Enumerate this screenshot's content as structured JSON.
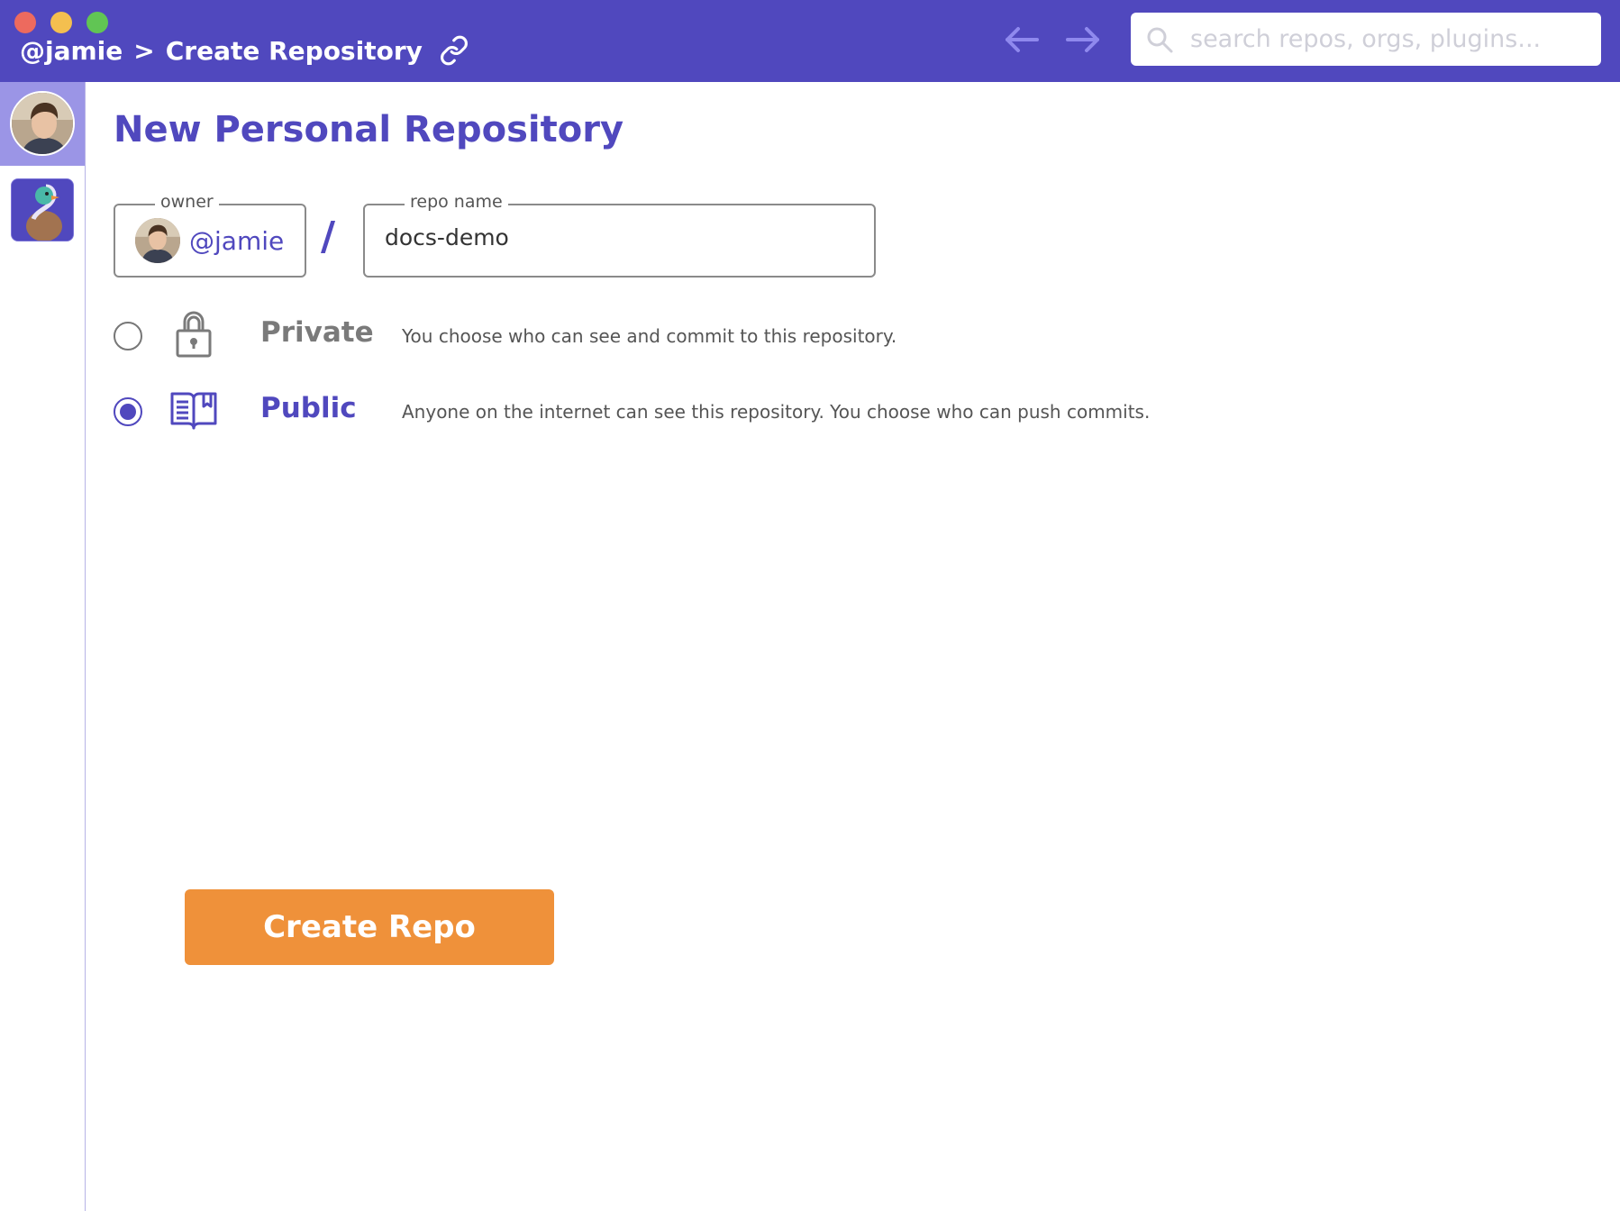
{
  "window": {
    "controls": [
      "close",
      "minimize",
      "maximize"
    ]
  },
  "header": {
    "breadcrumb_user": "@jamie",
    "breadcrumb_sep": ">",
    "breadcrumb_page": "Create Repository",
    "link_icon": "link-icon",
    "back_icon": "arrow-left-icon",
    "forward_icon": "arrow-right-icon",
    "search_placeholder": "search repos, orgs, plugins..."
  },
  "sidebar": {
    "items": [
      {
        "icon": "user-avatar",
        "active": true
      },
      {
        "icon": "duck-app-icon",
        "active": false
      }
    ]
  },
  "main": {
    "title": "New Personal Repository",
    "owner": {
      "legend": "owner",
      "value": "@jamie"
    },
    "slash": "/",
    "repo_name": {
      "legend": "repo name",
      "value": "docs-demo"
    },
    "visibility": {
      "selected": "public",
      "options": [
        {
          "id": "private",
          "icon": "lock-icon",
          "label": "Private",
          "description": "You choose who can see and commit to this repository."
        },
        {
          "id": "public",
          "icon": "book-icon",
          "label": "Public",
          "description": "Anyone on the internet can see this repository. You choose who can push commits."
        }
      ]
    },
    "create_button": "Create Repo"
  },
  "colors": {
    "brand": "#5048be",
    "accent": "#ef913a",
    "sidebar_active": "#9b95e6"
  }
}
